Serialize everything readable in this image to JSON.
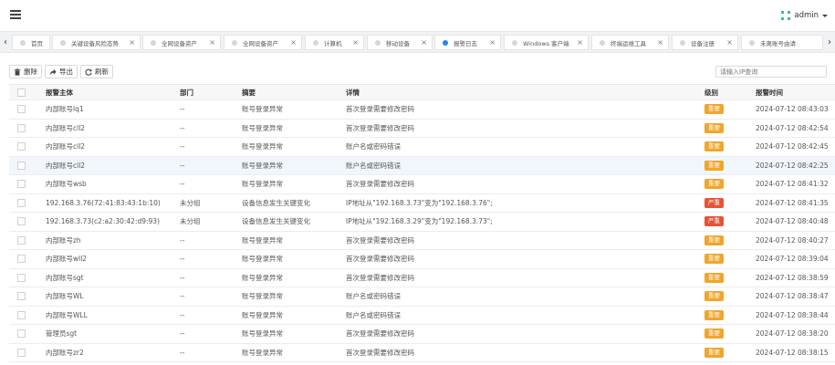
{
  "header": {
    "user": "admin"
  },
  "tabs": [
    {
      "label": "首页",
      "active": false
    },
    {
      "label": "关键设备风险态势",
      "active": false
    },
    {
      "label": "全网设备资产",
      "active": false
    },
    {
      "label": "全网设备资产",
      "active": false
    },
    {
      "label": "计算机",
      "active": false
    },
    {
      "label": "移动设备",
      "active": false
    },
    {
      "label": "报警日志",
      "active": true
    },
    {
      "label": "Windows 客户端",
      "active": false
    },
    {
      "label": "终端运维工具",
      "active": false
    },
    {
      "label": "设备注册",
      "active": false
    },
    {
      "label": "未离账号由请",
      "active": false
    }
  ],
  "toolbar": {
    "delete_label": "删除",
    "export_label": "导出",
    "refresh_label": "刷新"
  },
  "search": {
    "placeholder": "请输入IP查询"
  },
  "table": {
    "headers": [
      "报警主体",
      "部门",
      "摘要",
      "详情",
      "级别",
      "报警时间"
    ],
    "rows": [
      {
        "subject": "内部账号lq1",
        "dept": "--",
        "summary": "账号登录异常",
        "detail": "首次登录需要修改密码",
        "level": "重要",
        "level_type": "warn",
        "time": "2024-07-12 08:43:03"
      },
      {
        "subject": "内部账号cll2",
        "dept": "--",
        "summary": "账号登录异常",
        "detail": "首次登录需要修改密码",
        "level": "重要",
        "level_type": "warn",
        "time": "2024-07-12 08:42:54"
      },
      {
        "subject": "内部账号cll2",
        "dept": "--",
        "summary": "账号登录异常",
        "detail": "账户名或密码错误",
        "level": "重要",
        "level_type": "warn",
        "time": "2024-07-12 08:42:45"
      },
      {
        "subject": "内部账号cll2",
        "dept": "--",
        "summary": "账号登录异常",
        "detail": "账户名或密码错误",
        "level": "重要",
        "level_type": "warn",
        "time": "2024-07-12 08:42:25"
      },
      {
        "subject": "内部账号wsb",
        "dept": "--",
        "summary": "账号登录异常",
        "detail": "首次登录需要修改密码",
        "level": "重要",
        "level_type": "warn",
        "time": "2024-07-12 08:41:32"
      },
      {
        "subject": "192.168.3.76(72:41:83:43:1b:10)",
        "dept": "未分组",
        "summary": "设备信息发生关键变化",
        "detail": "IP地址从\"192.168.3.73\"变为\"192.168.3.76\";",
        "level": "严重",
        "level_type": "danger",
        "time": "2024-07-12 08:41:35"
      },
      {
        "subject": "192.168.3.73(c2:a2:30:42:d9:93)",
        "dept": "未分组",
        "summary": "设备信息发生关键变化",
        "detail": "IP地址从\"192.168.3.29\"变为\"192.168.3.73\";",
        "level": "严重",
        "level_type": "danger",
        "time": "2024-07-12 08:40:48"
      },
      {
        "subject": "内部账号zh",
        "dept": "--",
        "summary": "账号登录异常",
        "detail": "首次登录需要修改密码",
        "level": "重要",
        "level_type": "warn",
        "time": "2024-07-12 08:40:27"
      },
      {
        "subject": "内部账号wll2",
        "dept": "--",
        "summary": "账号登录异常",
        "detail": "首次登录需要修改密码",
        "level": "重要",
        "level_type": "warn",
        "time": "2024-07-12 08:39:04"
      },
      {
        "subject": "内部账号sgt",
        "dept": "--",
        "summary": "账号登录异常",
        "detail": "首次登录需要修改密码",
        "level": "重要",
        "level_type": "warn",
        "time": "2024-07-12 08:38:59"
      },
      {
        "subject": "内部账号WL",
        "dept": "--",
        "summary": "账号登录异常",
        "detail": "账户名或密码错误",
        "level": "重要",
        "level_type": "warn",
        "time": "2024-07-12 08:38:47"
      },
      {
        "subject": "内部账号WLL",
        "dept": "--",
        "summary": "账号登录异常",
        "detail": "账户名或密码错误",
        "level": "重要",
        "level_type": "warn",
        "time": "2024-07-12 08:38:44"
      },
      {
        "subject": "管理员sgt",
        "dept": "--",
        "summary": "账号登录异常",
        "detail": "首次登录需要修改密码",
        "level": "重要",
        "level_type": "warn",
        "time": "2024-07-12 08:38:20"
      },
      {
        "subject": "内部账号zr2",
        "dept": "--",
        "summary": "账号登录异常",
        "detail": "首次登录需要修改密码",
        "level": "重要",
        "level_type": "warn",
        "time": "2024-07-12 08:38:15"
      }
    ]
  }
}
